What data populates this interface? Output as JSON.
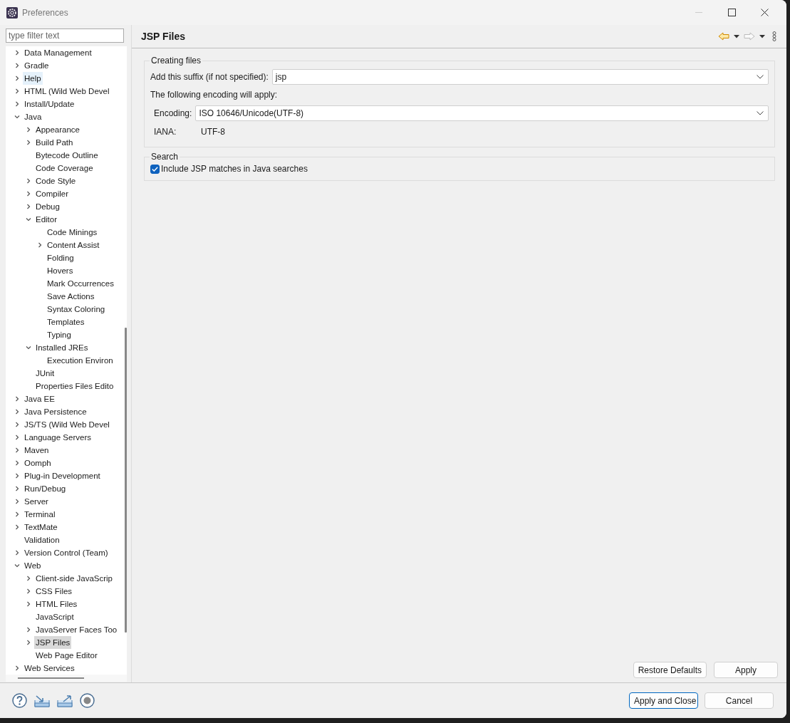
{
  "window": {
    "title": "Preferences"
  },
  "filter": {
    "placeholder": "type filter text"
  },
  "tree": [
    {
      "label": "Data Management",
      "expanded": false,
      "selected": false,
      "hovered": false
    },
    {
      "label": "Gradle",
      "expanded": false,
      "selected": false,
      "hovered": false
    },
    {
      "label": "Help",
      "expanded": false,
      "selected": false,
      "hovered": true
    },
    {
      "label": "HTML (Wild Web Devel",
      "expanded": false,
      "selected": false,
      "hovered": false
    },
    {
      "label": "Install/Update",
      "expanded": false,
      "selected": false,
      "hovered": false
    },
    {
      "label": "Java",
      "expanded": true,
      "selected": false,
      "hovered": false,
      "children": [
        {
          "label": "Appearance",
          "expanded": false,
          "selected": false,
          "hovered": false
        },
        {
          "label": "Build Path",
          "expanded": false,
          "selected": false,
          "hovered": false
        },
        {
          "label": "Bytecode Outline",
          "selected": false,
          "hovered": false
        },
        {
          "label": "Code Coverage",
          "selected": false,
          "hovered": false
        },
        {
          "label": "Code Style",
          "expanded": false,
          "selected": false,
          "hovered": false
        },
        {
          "label": "Compiler",
          "expanded": false,
          "selected": false,
          "hovered": false
        },
        {
          "label": "Debug",
          "expanded": false,
          "selected": false,
          "hovered": false
        },
        {
          "label": "Editor",
          "expanded": true,
          "selected": false,
          "hovered": false,
          "children": [
            {
              "label": "Code Minings",
              "selected": false,
              "hovered": false
            },
            {
              "label": "Content Assist",
              "expanded": false,
              "selected": false,
              "hovered": false
            },
            {
              "label": "Folding",
              "selected": false,
              "hovered": false
            },
            {
              "label": "Hovers",
              "selected": false,
              "hovered": false
            },
            {
              "label": "Mark Occurrences",
              "selected": false,
              "hovered": false
            },
            {
              "label": "Save Actions",
              "selected": false,
              "hovered": false
            },
            {
              "label": "Syntax Coloring",
              "selected": false,
              "hovered": false
            },
            {
              "label": "Templates",
              "selected": false,
              "hovered": false
            },
            {
              "label": "Typing",
              "selected": false,
              "hovered": false
            }
          ]
        },
        {
          "label": "Installed JREs",
          "expanded": true,
          "selected": false,
          "hovered": false,
          "children": [
            {
              "label": "Execution Environ",
              "selected": false,
              "hovered": false
            }
          ]
        },
        {
          "label": "JUnit",
          "selected": false,
          "hovered": false
        },
        {
          "label": "Properties Files Edito",
          "selected": false,
          "hovered": false
        }
      ]
    },
    {
      "label": "Java EE",
      "expanded": false,
      "selected": false,
      "hovered": false
    },
    {
      "label": "Java Persistence",
      "expanded": false,
      "selected": false,
      "hovered": false
    },
    {
      "label": "JS/TS (Wild Web Devel",
      "expanded": false,
      "selected": false,
      "hovered": false
    },
    {
      "label": "Language Servers",
      "expanded": false,
      "selected": false,
      "hovered": false
    },
    {
      "label": "Maven",
      "expanded": false,
      "selected": false,
      "hovered": false
    },
    {
      "label": "Oomph",
      "expanded": false,
      "selected": false,
      "hovered": false
    },
    {
      "label": "Plug-in Development",
      "expanded": false,
      "selected": false,
      "hovered": false
    },
    {
      "label": "Run/Debug",
      "expanded": false,
      "selected": false,
      "hovered": false
    },
    {
      "label": "Server",
      "expanded": false,
      "selected": false,
      "hovered": false
    },
    {
      "label": "Terminal",
      "expanded": false,
      "selected": false,
      "hovered": false
    },
    {
      "label": "TextMate",
      "expanded": false,
      "selected": false,
      "hovered": false
    },
    {
      "label": "Validation",
      "selected": false,
      "hovered": false
    },
    {
      "label": "Version Control (Team)",
      "expanded": false,
      "selected": false,
      "hovered": false
    },
    {
      "label": "Web",
      "expanded": true,
      "selected": false,
      "hovered": false,
      "children": [
        {
          "label": "Client-side JavaScrip",
          "expanded": false,
          "selected": false,
          "hovered": false
        },
        {
          "label": "CSS Files",
          "expanded": false,
          "selected": false,
          "hovered": false
        },
        {
          "label": "HTML Files",
          "expanded": false,
          "selected": false,
          "hovered": false
        },
        {
          "label": "JavaScript",
          "selected": false,
          "hovered": false
        },
        {
          "label": "JavaServer Faces Too",
          "expanded": false,
          "selected": false,
          "hovered": false
        },
        {
          "label": "JSP Files",
          "expanded": false,
          "selected": true,
          "hovered": false
        },
        {
          "label": "Web Page Editor",
          "selected": false,
          "hovered": false
        }
      ]
    },
    {
      "label": "Web Services",
      "expanded": false,
      "selected": false,
      "hovered": false
    }
  ],
  "page": {
    "title": "JSP Files",
    "nav": {
      "back_enabled": true,
      "forward_enabled": false
    },
    "creating_files": {
      "legend": "Creating files",
      "suffix_label": "Add this suffix (if not specified):",
      "suffix_value": "jsp",
      "encoding_note": "The following encoding will apply:",
      "encoding_label": "Encoding:",
      "encoding_value": "ISO 10646/Unicode(UTF-8)",
      "iana_label": "IANA:",
      "iana_value": "UTF-8"
    },
    "search": {
      "legend": "Search",
      "include_jsp": {
        "label": "Include JSP matches in Java searches",
        "checked": true
      }
    },
    "buttons": [
      "Restore Defaults",
      "Apply"
    ]
  },
  "footer_buttons": [
    {
      "label": "Apply and Close",
      "default": true
    },
    {
      "label": "Cancel",
      "default": false
    }
  ]
}
